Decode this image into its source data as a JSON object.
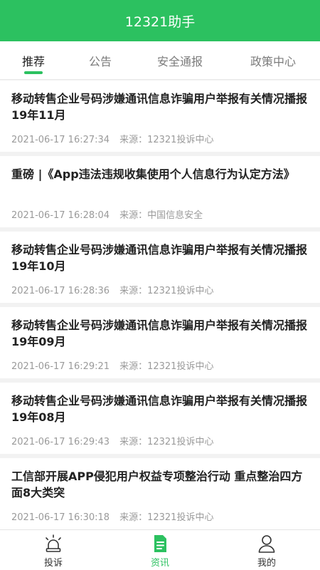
{
  "header": {
    "title": "12321助手"
  },
  "tabs": [
    {
      "label": "推荐"
    },
    {
      "label": "公告"
    },
    {
      "label": "安全通报"
    },
    {
      "label": "政策中心"
    }
  ],
  "active_tab": "推荐",
  "source_prefix": "来源：",
  "news": [
    {
      "title": "移动转售企业号码涉嫌通讯信息诈骗用户举报有关情况播报19年11月",
      "time": "2021-06-17 16:27:34",
      "source": "12321投诉中心"
    },
    {
      "title": "重磅 |《App违法违规收集使用个人信息行为认定方法》",
      "time": "2021-06-17 16:28:04",
      "source": "中国信息安全"
    },
    {
      "title": "移动转售企业号码涉嫌通讯信息诈骗用户举报有关情况播报19年10月",
      "time": "2021-06-17 16:28:36",
      "source": "12321投诉中心"
    },
    {
      "title": "移动转售企业号码涉嫌通讯信息诈骗用户举报有关情况播报19年09月",
      "time": "2021-06-17 16:29:21",
      "source": "12321投诉中心"
    },
    {
      "title": "移动转售企业号码涉嫌通讯信息诈骗用户举报有关情况播报19年08月",
      "time": "2021-06-17 16:29:43",
      "source": "12321投诉中心"
    },
    {
      "title": "工信部开展APP侵犯用户权益专项整治行动 重点整治四方面8大类突",
      "time": "2021-06-17 16:30:18",
      "source": "12321投诉中心"
    }
  ],
  "bottom_nav": [
    {
      "label": "投诉",
      "icon": "alarm-icon"
    },
    {
      "label": "资讯",
      "icon": "document-icon"
    },
    {
      "label": "我的",
      "icon": "user-icon"
    }
  ],
  "active_nav": "资讯",
  "colors": {
    "brand_green": "#2cc160",
    "title_text": "#222222",
    "meta_text": "#9a9a9a",
    "background": "#f2f2f2"
  }
}
